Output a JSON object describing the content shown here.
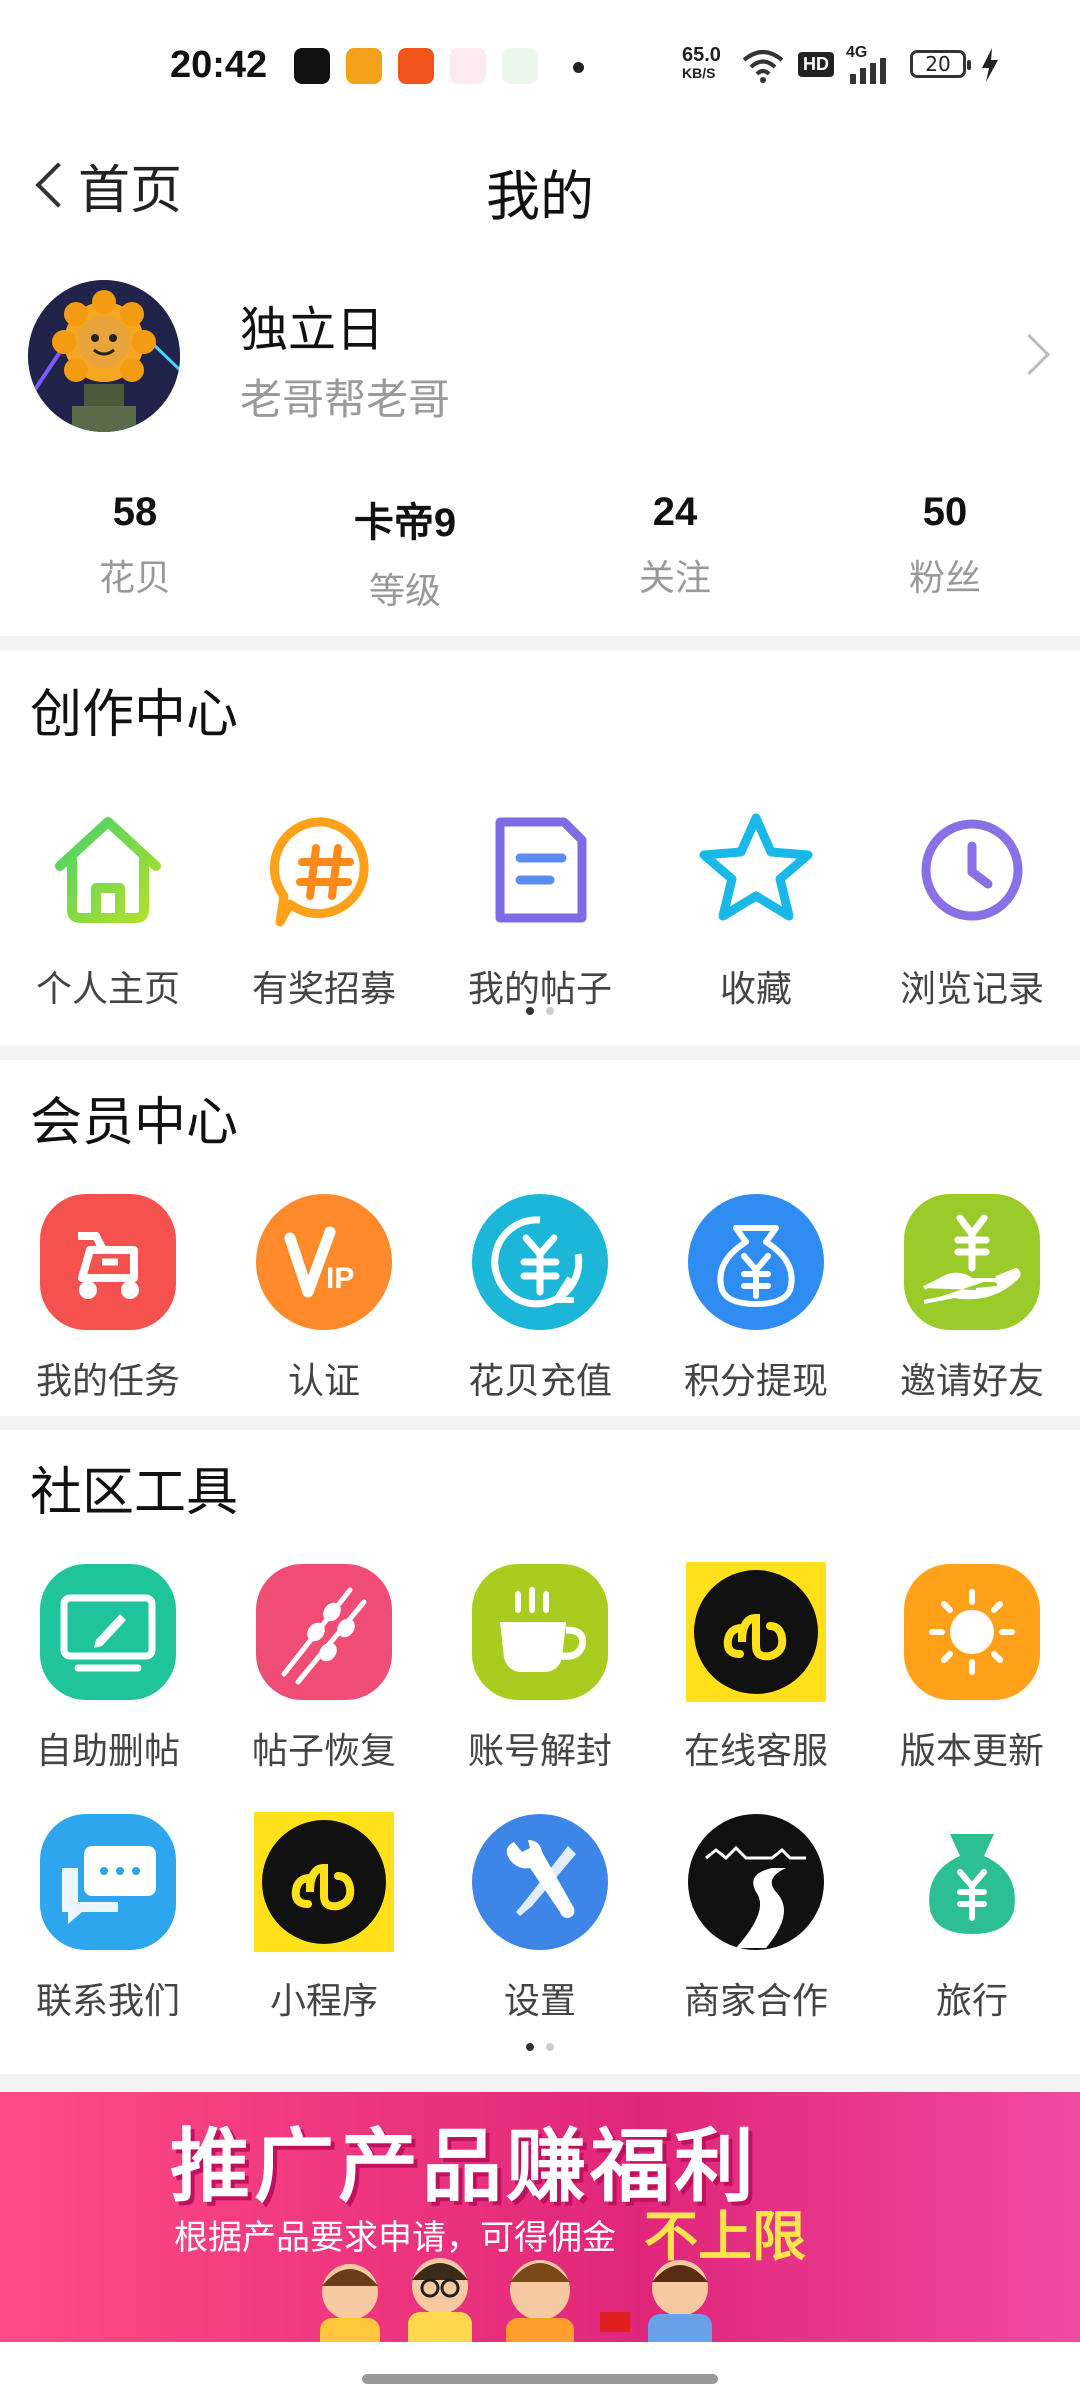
{
  "status_bar": {
    "time": "20:42",
    "net_speed_top": "65.0",
    "net_speed_unit": "KB/S",
    "hd": "HD",
    "signal": "4G",
    "battery": "20"
  },
  "header": {
    "back_label": "首页",
    "title": "我的"
  },
  "profile": {
    "name": "独立日",
    "signature": "老哥帮老哥"
  },
  "stats": [
    {
      "value": "58",
      "label": "花贝"
    },
    {
      "value": "卡帝9",
      "label": "等级"
    },
    {
      "value": "24",
      "label": "关注"
    },
    {
      "value": "50",
      "label": "粉丝"
    }
  ],
  "creation_center": {
    "title": "创作中心",
    "items": [
      {
        "label": "个人主页",
        "icon": "home-icon"
      },
      {
        "label": "有奖招募",
        "icon": "hashtag-bubble-icon"
      },
      {
        "label": "我的帖子",
        "icon": "document-icon"
      },
      {
        "label": "收藏",
        "icon": "star-icon"
      },
      {
        "label": "浏览记录",
        "icon": "clock-icon"
      }
    ]
  },
  "member_center": {
    "title": "会员中心",
    "items": [
      {
        "label": "我的任务",
        "icon": "scooter-icon",
        "color": "#f5524f"
      },
      {
        "label": "认证",
        "icon": "vip-icon",
        "color": "#ff8a2b"
      },
      {
        "label": "花贝充值",
        "icon": "yuan-recharge-icon",
        "color": "#1bb6d8"
      },
      {
        "label": "积分提现",
        "icon": "money-bag-icon",
        "color": "#2f8cf0"
      },
      {
        "label": "邀请好友",
        "icon": "hand-yuan-icon",
        "color": "#9acb2a"
      }
    ]
  },
  "community_tools": {
    "title": "社区工具",
    "items": [
      {
        "label": "自助删帖",
        "icon": "monitor-pen-icon",
        "color": "#1fc49a"
      },
      {
        "label": "帖子恢复",
        "icon": "skewer-icon",
        "color": "#f04d76"
      },
      {
        "label": "账号解封",
        "icon": "coffee-cup-icon",
        "color": "#a8cd1f"
      },
      {
        "label": "在线客服",
        "icon": "mini-program-icon",
        "color": "#ffe01b"
      },
      {
        "label": "版本更新",
        "icon": "sun-icon",
        "color": "#ffa21a"
      },
      {
        "label": "联系我们",
        "icon": "chat-bubbles-icon",
        "color": "#2ea6ee"
      },
      {
        "label": "小程序",
        "icon": "mini-program-icon",
        "color": "#ffe01b"
      },
      {
        "label": "设置",
        "icon": "tools-icon",
        "color": "#3d86e8"
      },
      {
        "label": "商家合作",
        "icon": "road-landscape-icon",
        "color": "#111111"
      },
      {
        "label": "旅行",
        "icon": "money-bag-icon",
        "color": "#2cbf94"
      }
    ]
  },
  "banner": {
    "title": "推广产品赚福利",
    "subtitle": "根据产品要求申请，可得佣金",
    "highlight": "不上限"
  }
}
